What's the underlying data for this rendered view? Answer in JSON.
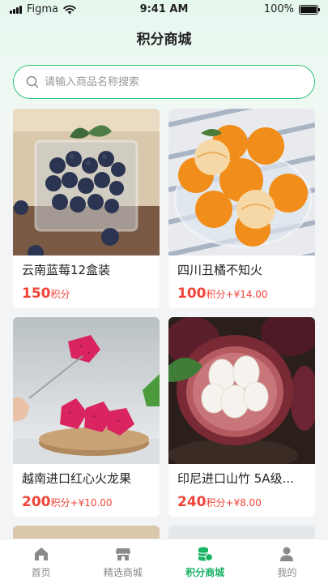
{
  "status": {
    "carrier": "Figma",
    "time": "9:41 AM",
    "battery": "100%"
  },
  "page_title": "积分商城",
  "search": {
    "placeholder": "请输入商品名称搜索"
  },
  "products": [
    {
      "name": "云南蓝莓12盒装",
      "points": "150",
      "points_unit": "积分",
      "cash": ""
    },
    {
      "name": "四川丑橘不知火",
      "points": "100",
      "points_unit": "积分",
      "cash": "+¥14.00"
    },
    {
      "name": "越南进口红心火龙果",
      "points": "200",
      "points_unit": "积分",
      "cash": "+¥10.00"
    },
    {
      "name": "印尼进口山竹 5A级...",
      "points": "240",
      "points_unit": "积分",
      "cash": "+¥8.00"
    }
  ],
  "tabs": [
    {
      "label": "首页",
      "icon": "home-icon"
    },
    {
      "label": "精选商城",
      "icon": "store-icon"
    },
    {
      "label": "积分商城",
      "icon": "coins-icon",
      "active": true
    },
    {
      "label": "我的",
      "icon": "user-icon"
    }
  ],
  "colors": {
    "accent": "#19b364",
    "price": "#f04438",
    "search_border": "#2fc27a"
  }
}
